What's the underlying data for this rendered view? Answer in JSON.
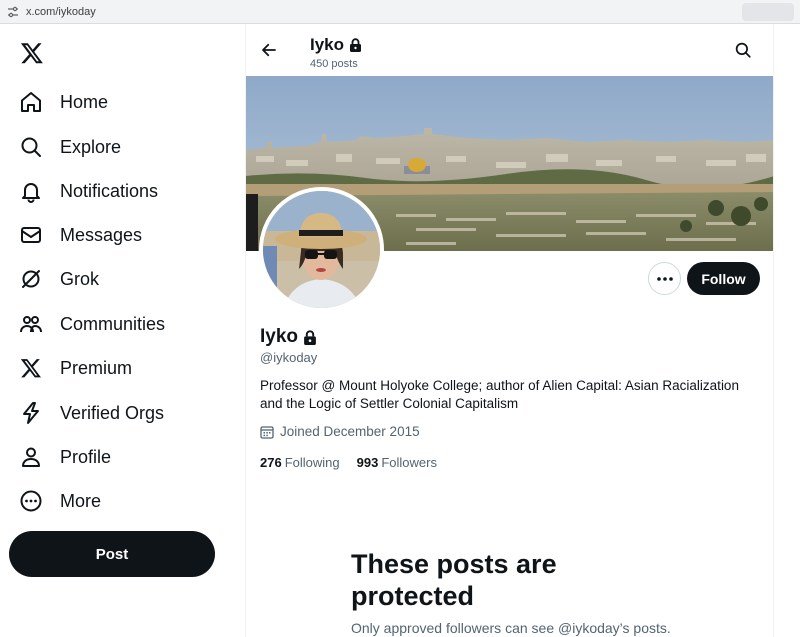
{
  "browser": {
    "url": "x.com/iykoday"
  },
  "sidebar": {
    "logo": "x-logo-icon",
    "items": [
      {
        "label": "Home",
        "icon": "home-icon"
      },
      {
        "label": "Explore",
        "icon": "search-icon"
      },
      {
        "label": "Notifications",
        "icon": "bell-icon"
      },
      {
        "label": "Messages",
        "icon": "envelope-icon"
      },
      {
        "label": "Grok",
        "icon": "grok-icon"
      },
      {
        "label": "Communities",
        "icon": "communities-icon"
      },
      {
        "label": "Premium",
        "icon": "x-logo-icon"
      },
      {
        "label": "Verified Orgs",
        "icon": "lightning-icon"
      },
      {
        "label": "Profile",
        "icon": "person-icon"
      },
      {
        "label": "More",
        "icon": "more-circle-icon"
      }
    ],
    "post_label": "Post"
  },
  "header": {
    "name": "Iyko",
    "post_count": "450 posts"
  },
  "profile": {
    "name": "Iyko",
    "handle": "@iykoday",
    "bio": "Professor @ Mount Holyoke College; author of Alien Capital: Asian Racialization and the Logic of Settler Colonial Capitalism",
    "joined": "Joined December 2015",
    "following_count": "276",
    "following_label": "Following",
    "followers_count": "993",
    "followers_label": "Followers",
    "follow_label": "Follow"
  },
  "protected": {
    "title": "These posts are protected",
    "subtitle": "Only approved followers can see @iykoday’s posts."
  },
  "colors": {
    "text": "#0f1419",
    "secondary": "#536471",
    "border": "#eff3f4",
    "button": "#0f1419"
  }
}
